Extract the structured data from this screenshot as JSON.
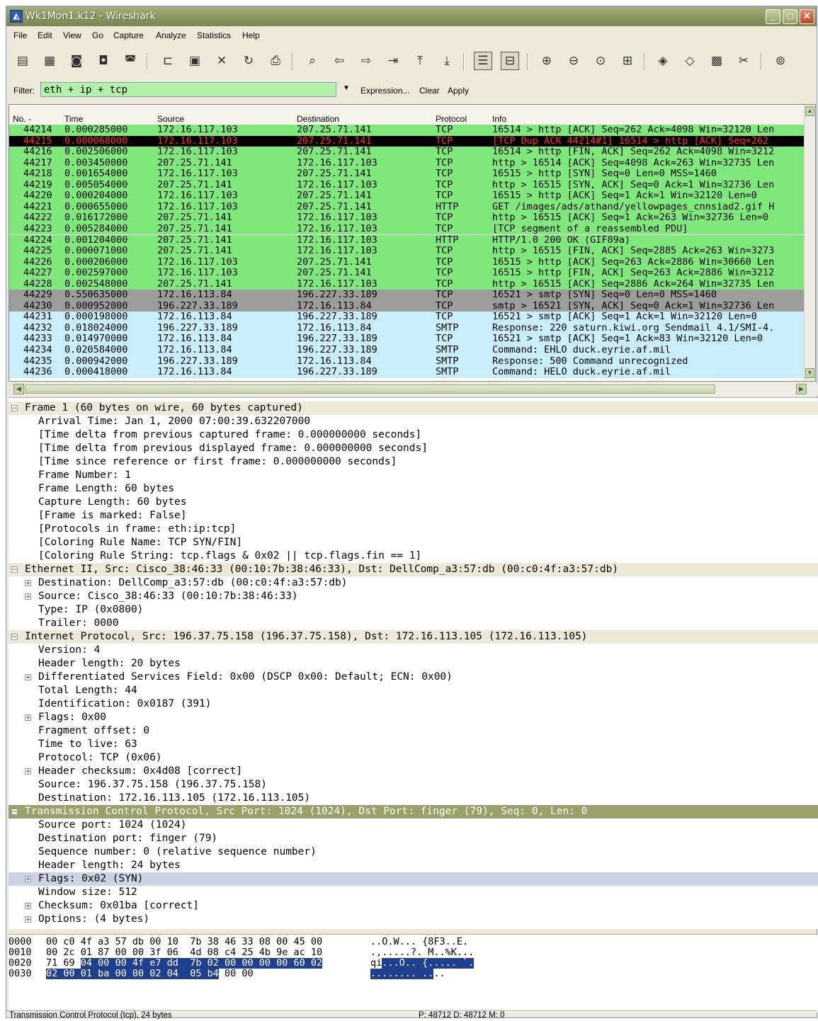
{
  "window": {
    "title": "Wk1Mon1.k12 - Wireshark",
    "controls": {
      "minimize": "_",
      "maximize": "□",
      "close": "✕"
    }
  },
  "menu": [
    "File",
    "Edit",
    "View",
    "Go",
    "Capture",
    "Analyze",
    "Statistics",
    "Help"
  ],
  "filter": {
    "label": "Filter:",
    "value": "eth + ip + tcp",
    "expression": "Expression...",
    "clear": "Clear",
    "apply": "Apply"
  },
  "columns": {
    "no": "No. -",
    "time": "Time",
    "source": "Source",
    "destination": "Destination",
    "protocol": "Protocol",
    "info": "Info"
  },
  "colors": {
    "green": "#7fe87a",
    "blue": "#c8eefc",
    "gray": "#9c9c9c",
    "selected_row": "#000000",
    "selected_text": "#ff2b2b",
    "tcp_header_bar": "#99a069",
    "hex_highlight": "#1f3f8f"
  },
  "packets": [
    {
      "no": "44214",
      "time": "0.000285000",
      "src": "172.16.117.103",
      "dst": "207.25.71.141",
      "proto": "TCP",
      "info": "16514 > http [ACK] Seq=262 Ack=4098 Win=32120 Len",
      "color": "green"
    },
    {
      "no": "44215",
      "time": "0.000068000",
      "src": "172.16.117.103",
      "dst": "207.25.71.141",
      "proto": "TCP",
      "info": "[TCP Dup ACK 44214#1] 16514 > http [ACK] Seq=262",
      "color": "selected"
    },
    {
      "no": "44216",
      "time": "0.002506000",
      "src": "172.16.117.103",
      "dst": "207.25.71.141",
      "proto": "TCP",
      "info": "16514 > http [FIN, ACK] Seq=262 Ack=4098 Win=3212",
      "color": "green"
    },
    {
      "no": "44217",
      "time": "0.003450000",
      "src": "207.25.71.141",
      "dst": "172.16.117.103",
      "proto": "TCP",
      "info": "http > 16514 [ACK] Seq=4098 Ack=263 Win=32735 Len",
      "color": "green"
    },
    {
      "no": "44218",
      "time": "0.001654000",
      "src": "172.16.117.103",
      "dst": "207.25.71.141",
      "proto": "TCP",
      "info": "16515 > http [SYN] Seq=0 Len=0 MSS=1460",
      "color": "green"
    },
    {
      "no": "44219",
      "time": "0.005054000",
      "src": "207.25.71.141",
      "dst": "172.16.117.103",
      "proto": "TCP",
      "info": "http > 16515 [SYN, ACK] Seq=0 Ack=1 Win=32736 Len",
      "color": "green"
    },
    {
      "no": "44220",
      "time": "0.000204000",
      "src": "172.16.117.103",
      "dst": "207.25.71.141",
      "proto": "TCP",
      "info": "16515 > http [ACK] Seq=1 Ack=1 Win=32120 Len=0",
      "color": "green"
    },
    {
      "no": "44221",
      "time": "0.000655000",
      "src": "172.16.117.103",
      "dst": "207.25.71.141",
      "proto": "HTTP",
      "info": "GET /images/ads/athand/yellowpages_cnnsiad2.gif H",
      "color": "green"
    },
    {
      "no": "44222",
      "time": "0.016172000",
      "src": "207.25.71.141",
      "dst": "172.16.117.103",
      "proto": "TCP",
      "info": "http > 16515 [ACK] Seq=1 Ack=263 Win=32736 Len=0",
      "color": "green"
    },
    {
      "no": "44223",
      "time": "0.005284000",
      "src": "207.25.71.141",
      "dst": "172.16.117.103",
      "proto": "TCP",
      "info": "[TCP segment of a reassembled PDU]",
      "color": "green"
    },
    {
      "no": "44224",
      "time": "0.001204000",
      "src": "207.25.71.141",
      "dst": "172.16.117.103",
      "proto": "HTTP",
      "info": "HTTP/1.0 200 OK (GIF89a)",
      "color": "green"
    },
    {
      "no": "44225",
      "time": "0.000071000",
      "src": "207.25.71.141",
      "dst": "172.16.117.103",
      "proto": "TCP",
      "info": "http > 16515 [FIN, ACK] Seq=2885 Ack=263 Win=3273",
      "color": "green"
    },
    {
      "no": "44226",
      "time": "0.000206000",
      "src": "172.16.117.103",
      "dst": "207.25.71.141",
      "proto": "TCP",
      "info": "16515 > http [ACK] Seq=263 Ack=2886 Win=30660 Len",
      "color": "green"
    },
    {
      "no": "44227",
      "time": "0.002597000",
      "src": "172.16.117.103",
      "dst": "207.25.71.141",
      "proto": "TCP",
      "info": "16515 > http [FIN, ACK] Seq=263 Ack=2886 Win=3212",
      "color": "green"
    },
    {
      "no": "44228",
      "time": "0.002548000",
      "src": "207.25.71.141",
      "dst": "172.16.117.103",
      "proto": "TCP",
      "info": "http > 16515 [ACK] Seq=2886 Ack=264 Win=32735 Len",
      "color": "green"
    },
    {
      "no": "44229",
      "time": "0.550635000",
      "src": "172.16.113.84",
      "dst": "196.227.33.189",
      "proto": "TCP",
      "info": "16521 > smtp [SYN] Seq=0 Len=0 MSS=1460",
      "color": "gray"
    },
    {
      "no": "44230",
      "time": "0.000952000",
      "src": "196.227.33.189",
      "dst": "172.16.113.84",
      "proto": "TCP",
      "info": "smtp > 16521 [SYN, ACK] Seq=0 Ack=1 Win=32736 Len",
      "color": "gray"
    },
    {
      "no": "44231",
      "time": "0.000198000",
      "src": "172.16.113.84",
      "dst": "196.227.33.189",
      "proto": "TCP",
      "info": "16521 > smtp [ACK] Seq=1 Ack=1 Win=32120 Len=0",
      "color": "blue"
    },
    {
      "no": "44232",
      "time": "0.018024000",
      "src": "196.227.33.189",
      "dst": "172.16.113.84",
      "proto": "SMTP",
      "info": "Response: 220 saturn.kiwi.org Sendmail 4.1/SMI-4.",
      "color": "blue"
    },
    {
      "no": "44233",
      "time": "0.014970000",
      "src": "172.16.113.84",
      "dst": "196.227.33.189",
      "proto": "TCP",
      "info": "16521 > smtp [ACK] Seq=1 Ack=83 Win=32120 Len=0",
      "color": "blue"
    },
    {
      "no": "44234",
      "time": "0.020584000",
      "src": "172.16.113.84",
      "dst": "196.227.33.189",
      "proto": "SMTP",
      "info": "Command: EHLO duck.eyrie.af.mil",
      "color": "blue"
    },
    {
      "no": "44235",
      "time": "0.000942000",
      "src": "196.227.33.189",
      "dst": "172.16.113.84",
      "proto": "SMTP",
      "info": "Response: 500 Command unrecognized",
      "color": "blue"
    },
    {
      "no": "44236",
      "time": "0.000418000",
      "src": "172.16.113.84",
      "dst": "196.227.33.189",
      "proto": "SMTP",
      "info": "Command: HELO duck.eyrie.af.mil",
      "color": "blue"
    }
  ],
  "details": [
    {
      "text": "Frame 1 (60 bytes on wire, 60 bytes captured)",
      "level": 0,
      "expander": "−",
      "style": "hdr"
    },
    {
      "text": "Arrival Time: Jan  1, 2000 07:00:39.632207000",
      "level": 1,
      "expander": "",
      "style": ""
    },
    {
      "text": "[Time delta from previous captured frame: 0.000000000 seconds]",
      "level": 1,
      "expander": "",
      "style": ""
    },
    {
      "text": "[Time delta from previous displayed frame: 0.000000000 seconds]",
      "level": 1,
      "expander": "",
      "style": ""
    },
    {
      "text": "[Time since reference or first frame: 0.000000000 seconds]",
      "level": 1,
      "expander": "",
      "style": ""
    },
    {
      "text": "Frame Number: 1",
      "level": 1,
      "expander": "",
      "style": ""
    },
    {
      "text": "Frame Length: 60 bytes",
      "level": 1,
      "expander": "",
      "style": ""
    },
    {
      "text": "Capture Length: 60 bytes",
      "level": 1,
      "expander": "",
      "style": ""
    },
    {
      "text": "[Frame is marked: False]",
      "level": 1,
      "expander": "",
      "style": ""
    },
    {
      "text": "[Protocols in frame: eth:ip:tcp]",
      "level": 1,
      "expander": "",
      "style": ""
    },
    {
      "text": "[Coloring Rule Name: TCP SYN/FIN]",
      "level": 1,
      "expander": "",
      "style": ""
    },
    {
      "text": "[Coloring Rule String: tcp.flags & 0x02 || tcp.flags.fin == 1]",
      "level": 1,
      "expander": "",
      "style": ""
    },
    {
      "text": "Ethernet II, Src: Cisco_38:46:33 (00:10:7b:38:46:33), Dst: DellComp_a3:57:db (00:c0:4f:a3:57:db)",
      "level": 0,
      "expander": "−",
      "style": "hdr"
    },
    {
      "text": "Destination: DellComp_a3:57:db (00:c0:4f:a3:57:db)",
      "level": 1,
      "expander": "+",
      "style": ""
    },
    {
      "text": "Source: Cisco_38:46:33 (00:10:7b:38:46:33)",
      "level": 1,
      "expander": "+",
      "style": ""
    },
    {
      "text": "Type: IP (0x0800)",
      "level": 1,
      "expander": "",
      "style": ""
    },
    {
      "text": "Trailer: 0000",
      "level": 1,
      "expander": "",
      "style": ""
    },
    {
      "text": "Internet Protocol, Src: 196.37.75.158 (196.37.75.158), Dst: 172.16.113.105 (172.16.113.105)",
      "level": 0,
      "expander": "−",
      "style": "hdr"
    },
    {
      "text": "Version: 4",
      "level": 1,
      "expander": "",
      "style": ""
    },
    {
      "text": "Header length: 20 bytes",
      "level": 1,
      "expander": "",
      "style": ""
    },
    {
      "text": "Differentiated Services Field: 0x00 (DSCP 0x00: Default; ECN: 0x00)",
      "level": 1,
      "expander": "+",
      "style": ""
    },
    {
      "text": "Total Length: 44",
      "level": 1,
      "expander": "",
      "style": ""
    },
    {
      "text": "Identification: 0x0187 (391)",
      "level": 1,
      "expander": "",
      "style": ""
    },
    {
      "text": "Flags: 0x00",
      "level": 1,
      "expander": "+",
      "style": ""
    },
    {
      "text": "Fragment offset: 0",
      "level": 1,
      "expander": "",
      "style": ""
    },
    {
      "text": "Time to live: 63",
      "level": 1,
      "expander": "",
      "style": ""
    },
    {
      "text": "Protocol: TCP (0x06)",
      "level": 1,
      "expander": "",
      "style": ""
    },
    {
      "text": "Header checksum: 0x4d08 [correct]",
      "level": 1,
      "expander": "+",
      "style": ""
    },
    {
      "text": "Source: 196.37.75.158 (196.37.75.158)",
      "level": 1,
      "expander": "",
      "style": ""
    },
    {
      "text": "Destination: 172.16.113.105 (172.16.113.105)",
      "level": 1,
      "expander": "",
      "style": ""
    },
    {
      "text": "Transmission Control Protocol, Src Port: 1024 (1024), Dst Port: finger (79), Seq: 0, Len: 0",
      "level": 0,
      "expander": "−",
      "style": "seltop"
    },
    {
      "text": "Source port: 1024 (1024)",
      "level": 1,
      "expander": "",
      "style": ""
    },
    {
      "text": "Destination port: finger (79)",
      "level": 1,
      "expander": "",
      "style": ""
    },
    {
      "text": "Sequence number: 0    (relative sequence number)",
      "level": 1,
      "expander": "",
      "style": ""
    },
    {
      "text": "Header length: 24 bytes",
      "level": 1,
      "expander": "",
      "style": ""
    },
    {
      "text": "Flags: 0x02 (SYN)",
      "level": 1,
      "expander": "+",
      "style": "sel"
    },
    {
      "text": "Window size: 512",
      "level": 1,
      "expander": "",
      "style": ""
    },
    {
      "text": "Checksum: 0x01ba [correct]",
      "level": 1,
      "expander": "+",
      "style": ""
    },
    {
      "text": "Options: (4 bytes)",
      "level": 1,
      "expander": "+",
      "style": ""
    }
  ],
  "hex": [
    {
      "offset": "0000",
      "pre": "00 c0 4f a3 57 db 00 10  7b 38 46 33 08 00 45 00",
      "hl": "",
      "post": "",
      "ascii_pre": "..O.W... {8F3..E.",
      "ascii_hl": "",
      "ascii_post": ""
    },
    {
      "offset": "0010",
      "pre": "00 2c 01 87 00 00 3f 06  4d 08 c4 25 4b 9e ac 10",
      "hl": "",
      "post": "",
      "ascii_pre": ".,.....?. M..%K...",
      "ascii_hl": "",
      "ascii_post": ""
    },
    {
      "offset": "0020",
      "pre": "71 69 ",
      "hl": "04 00 00 4f e7 dd  7b 02 00 00 00 00 60 02",
      "post": "",
      "ascii_pre": "qi",
      "ascii_hl": "...O.. {..... `.",
      "ascii_post": ""
    },
    {
      "offset": "0030",
      "pre": "",
      "hl": "02 00 01 ba 00 00 02 04  05 b4",
      "post": " 00 00",
      "ascii_pre": "",
      "ascii_hl": "........ ..",
      "ascii_post": ".."
    }
  ],
  "status": {
    "left": "Transmission Control Protocol (tcp), 24 bytes",
    "right": "P: 48712 D: 48712 M: 0"
  }
}
